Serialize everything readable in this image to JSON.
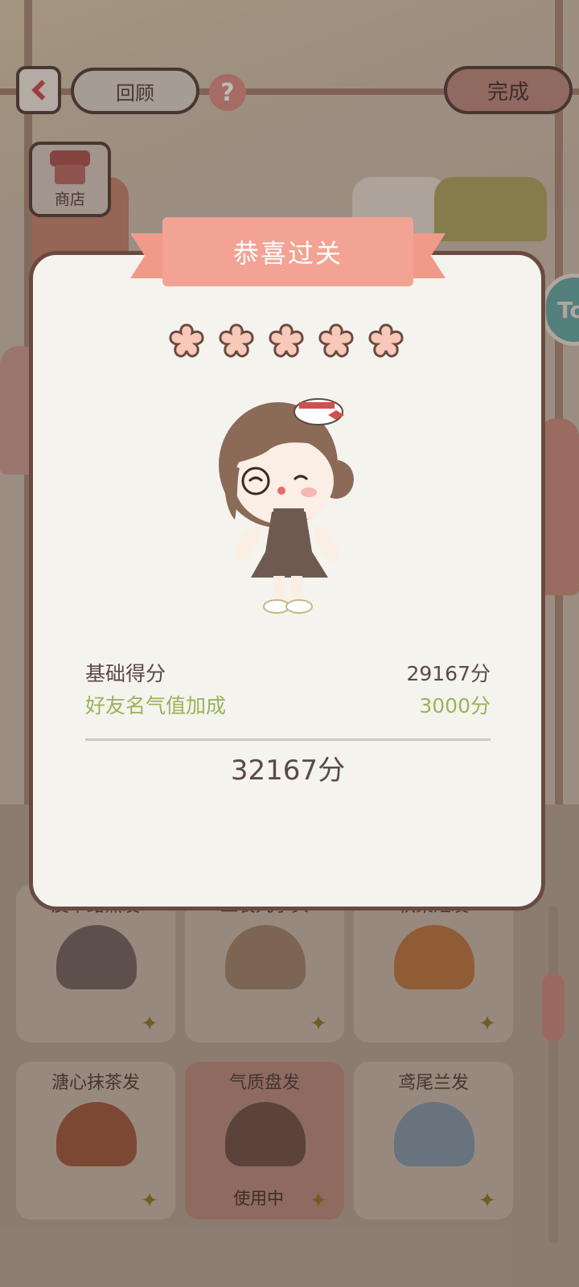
{
  "top_bar": {
    "review_label": "回顾",
    "help_symbol": "?",
    "done_label": "完成",
    "shop_label": "商店",
    "side_tab_text": "To"
  },
  "result": {
    "title": "恭喜过关",
    "stars_count": 5,
    "base_score_label": "基础得分",
    "base_score_value": "29167分",
    "bonus_label": "好友名气值加成",
    "bonus_value": "3000分",
    "total_value": "32167分"
  },
  "hair_items": [
    {
      "name": "皮卡路黑发",
      "color": "#6e625d",
      "in_use": false,
      "badge": "✦"
    },
    {
      "name": "工装丸子头",
      "color": "#9c8168",
      "in_use": false,
      "badge": "✦"
    },
    {
      "name": "秋栗短发",
      "color": "#b8733c",
      "in_use": false,
      "badge": "✦"
    },
    {
      "name": "溏心抹茶发",
      "color": "#9c5638",
      "in_use": false,
      "badge": "✦"
    },
    {
      "name": "气质盘发",
      "color": "#6b4f45",
      "in_use": true,
      "in_use_label": "使用中",
      "badge": "✦"
    },
    {
      "name": "鸢尾兰发",
      "color": "#7e96a7",
      "in_use": false,
      "badge": "✦"
    }
  ],
  "colors": {
    "accent_pink": "#f3a393",
    "bonus_green": "#98b35b",
    "text_brown": "#5a4a42"
  }
}
